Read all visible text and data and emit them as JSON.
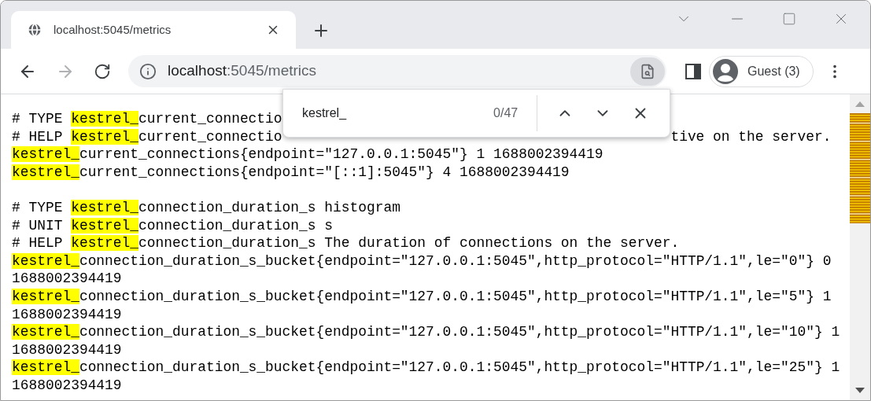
{
  "tab": {
    "title": "localhost:5045/metrics",
    "selected": true
  },
  "address_bar": {
    "host": "localhost",
    "path": ":5045/metrics"
  },
  "profile": {
    "label": "Guest (3)"
  },
  "find_bar": {
    "query": "kestrel_",
    "count": "0/47"
  },
  "lines": [
    {
      "kind": "text",
      "segments": [
        {
          "text": "# TYPE ",
          "highlighted": false
        },
        {
          "text": "kestrel_",
          "highlighted": true
        },
        {
          "text": "current_connectio",
          "highlighted": false
        }
      ]
    },
    {
      "kind": "text",
      "segments": [
        {
          "text": "# HELP ",
          "highlighted": false
        },
        {
          "text": "kestrel_",
          "highlighted": true
        },
        {
          "text": "current_connectio",
          "highlighted": false
        }
      ],
      "tail": "tive on the server."
    },
    {
      "kind": "text",
      "segments": [
        {
          "text": "kestrel_",
          "highlighted": true
        },
        {
          "text": "current_connections{endpoint=\"127.0.0.1:5045\"} 1 1688002394419",
          "highlighted": false
        }
      ]
    },
    {
      "kind": "text",
      "segments": [
        {
          "text": "kestrel_",
          "highlighted": true
        },
        {
          "text": "current_connections{endpoint=\"[::1]:5045\"} 4 1688002394419",
          "highlighted": false
        }
      ]
    },
    {
      "kind": "blank"
    },
    {
      "kind": "text",
      "segments": [
        {
          "text": "# TYPE ",
          "highlighted": false
        },
        {
          "text": "kestrel_",
          "highlighted": true
        },
        {
          "text": "connection_duration_s histogram",
          "highlighted": false
        }
      ]
    },
    {
      "kind": "text",
      "segments": [
        {
          "text": "# UNIT ",
          "highlighted": false
        },
        {
          "text": "kestrel_",
          "highlighted": true
        },
        {
          "text": "connection_duration_s s",
          "highlighted": false
        }
      ]
    },
    {
      "kind": "text",
      "segments": [
        {
          "text": "# HELP ",
          "highlighted": false
        },
        {
          "text": "kestrel_",
          "highlighted": true
        },
        {
          "text": "connection_duration_s The duration of connections on the server.",
          "highlighted": false
        }
      ]
    },
    {
      "kind": "text",
      "segments": [
        {
          "text": "kestrel_",
          "highlighted": true
        },
        {
          "text": "connection_duration_s_bucket{endpoint=\"127.0.0.1:5045\",http_protocol=\"HTTP/1.1\",le=\"0\"} 0",
          "highlighted": false
        }
      ]
    },
    {
      "kind": "text",
      "segments": [
        {
          "text": "1688002394419",
          "highlighted": false
        }
      ]
    },
    {
      "kind": "text",
      "segments": [
        {
          "text": "kestrel_",
          "highlighted": true
        },
        {
          "text": "connection_duration_s_bucket{endpoint=\"127.0.0.1:5045\",http_protocol=\"HTTP/1.1\",le=\"5\"} 1",
          "highlighted": false
        }
      ]
    },
    {
      "kind": "text",
      "segments": [
        {
          "text": "1688002394419",
          "highlighted": false
        }
      ]
    },
    {
      "kind": "text",
      "segments": [
        {
          "text": "kestrel_",
          "highlighted": true
        },
        {
          "text": "connection_duration_s_bucket{endpoint=\"127.0.0.1:5045\",http_protocol=\"HTTP/1.1\",le=\"10\"} 1",
          "highlighted": false
        }
      ]
    },
    {
      "kind": "text",
      "segments": [
        {
          "text": "1688002394419",
          "highlighted": false
        }
      ]
    },
    {
      "kind": "text",
      "segments": [
        {
          "text": "kestrel_",
          "highlighted": true
        },
        {
          "text": "connection_duration_s_bucket{endpoint=\"127.0.0.1:5045\",http_protocol=\"HTTP/1.1\",le=\"25\"} 1",
          "highlighted": false
        }
      ]
    },
    {
      "kind": "text",
      "segments": [
        {
          "text": "1688002394419",
          "highlighted": false
        }
      ]
    }
  ]
}
